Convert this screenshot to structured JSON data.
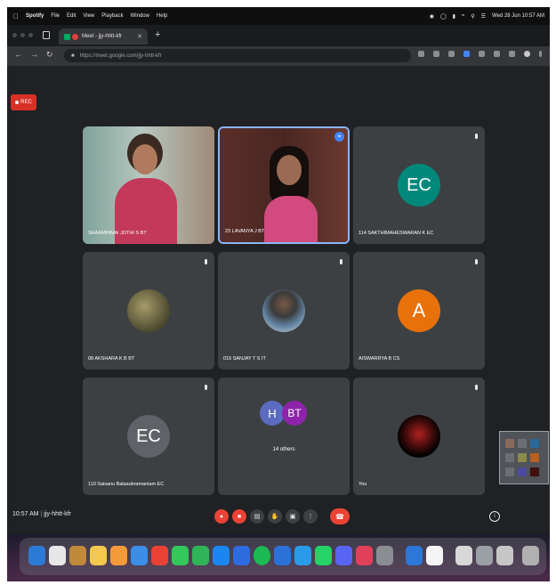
{
  "menubar": {
    "app": "Spotify",
    "items": [
      "File",
      "Edit",
      "View",
      "Playback",
      "Window",
      "Help"
    ],
    "datetime": "Wed 28 Jun 10:57 AM"
  },
  "browser": {
    "tab_title": "Meet - jjy-hhtt-kfr",
    "url": "https://meet.google.com/jjy-hhtt-kfr"
  },
  "meet": {
    "rec_label": "REC",
    "meeting_time": "10:57 AM",
    "meeting_code": "jjy-hhtt-kfr",
    "participants": [
      {
        "name": "SHAAMPAVAI JOTHI S BT",
        "type": "video",
        "avatar_letter": ""
      },
      {
        "name": "23 LAVANYA J BT",
        "type": "video",
        "avatar_letter": ""
      },
      {
        "name": "114 SAKTHIMAHESWARAN K EC",
        "type": "avatar",
        "avatar_letter": "EC"
      },
      {
        "name": "08 AKSHARA K B BT",
        "type": "image",
        "avatar_letter": ""
      },
      {
        "name": "015 SANJAY T S IT",
        "type": "image",
        "avatar_letter": ""
      },
      {
        "name": "AISWARRYA B CS",
        "type": "avatar",
        "avatar_letter": "A"
      },
      {
        "name": "110 Saisanu Balasubramaniam EC",
        "type": "avatar",
        "avatar_letter": "EC"
      },
      {
        "name": "14 others",
        "type": "group",
        "avatar_letter": "H",
        "avatar_letter_2": "BT"
      },
      {
        "name": "You",
        "type": "image",
        "avatar_letter": ""
      }
    ]
  },
  "colors": {
    "stage": "#202124",
    "tile": "#3c4043",
    "avatar_ec": "#00897b",
    "avatar_a": "#e8710a",
    "avatar_h": "#5c6bc0",
    "avatar_bt": "#8e24aa",
    "end_call": "#ea4335"
  }
}
